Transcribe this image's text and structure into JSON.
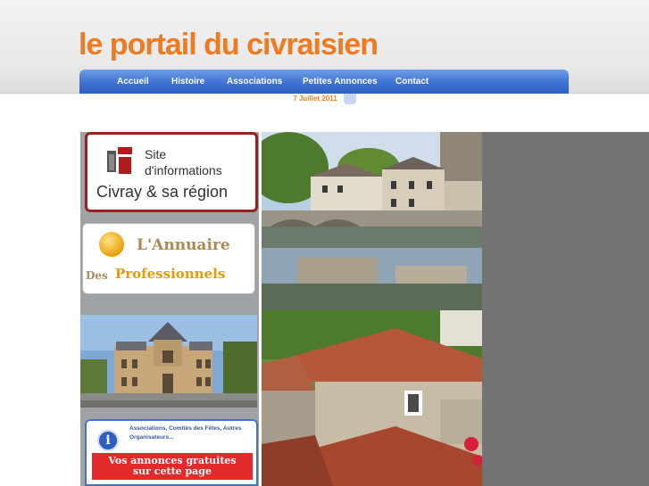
{
  "header": {
    "site_title": "le portail du civraisien",
    "date": "7 Juillet 2011"
  },
  "nav": {
    "items": [
      {
        "label": "Accueil"
      },
      {
        "label": "Histoire"
      },
      {
        "label": "Associations"
      },
      {
        "label": "Petites Annonces"
      },
      {
        "label": "Contact"
      }
    ]
  },
  "sidebar": {
    "promo": {
      "line1": "Site",
      "line2": "d'informations",
      "line3": "Civray & sa région",
      "icon": "info-i-icon"
    },
    "annuaire": {
      "line1": "L'Annuaire",
      "line2_des": "Des",
      "line2_pro": "Professionnels",
      "icon": "gold-medal-icon"
    },
    "associations": {
      "text": "Associations, Comités des Fêtes, Autres Organisateurs...",
      "banner_line1": "Vos annonces gratuites",
      "banner_line2": "sur cette page",
      "icon": "info-circle-icon"
    }
  },
  "colors": {
    "title": "#f07a22",
    "nav": "#3f72d2",
    "promo_border": "#9b1f1f",
    "assoc_banner": "#e32a2a",
    "right_block": "#737373"
  }
}
